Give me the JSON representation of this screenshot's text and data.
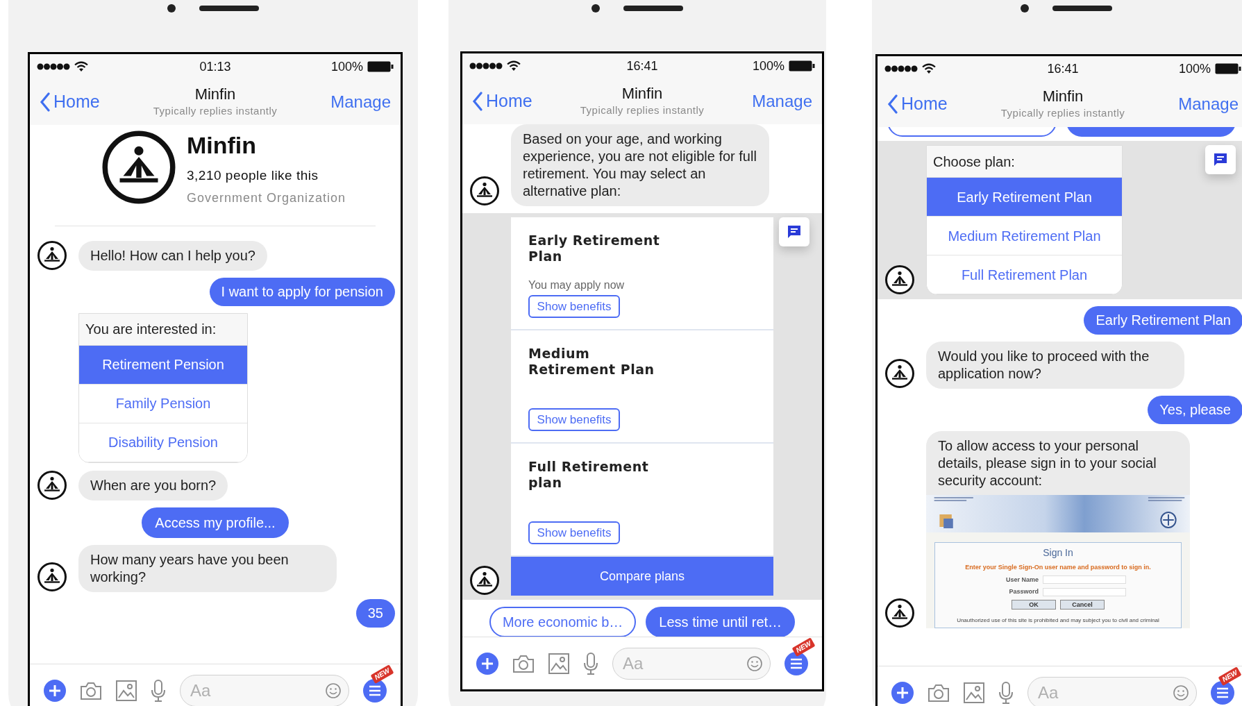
{
  "phones": [
    {
      "status": {
        "time": "01:13",
        "battery": "100%"
      },
      "header": {
        "back": "Home",
        "title": "Minfin",
        "subtitle": "Typically replies instantly",
        "action": "Manage"
      },
      "messages": [
        {
          "kind": "profile",
          "name": "Minfin",
          "likes": "3,210 people like this",
          "category": "Government Organization"
        },
        {
          "kind": "bot",
          "avatar": true,
          "text": "Hello! How can I help you?"
        },
        {
          "kind": "user",
          "text": "I want to apply for pension"
        },
        {
          "kind": "options",
          "avatar": false,
          "highlighted": false,
          "prompt": "You are interested in:",
          "options": [
            {
              "label": "Retirement Pension",
              "selected": true
            },
            {
              "label": "Family Pension",
              "selected": false
            },
            {
              "label": "Disability Pension",
              "selected": false
            }
          ]
        },
        {
          "kind": "bot",
          "avatar": true,
          "text": "When are you born?"
        },
        {
          "kind": "quick_replies",
          "replies": [
            {
              "label": "Access my profile...",
              "selected": true
            }
          ]
        },
        {
          "kind": "bot",
          "avatar": true,
          "text": "How many years have you been working?"
        },
        {
          "kind": "user",
          "text": "35"
        }
      ],
      "composer": {
        "placeholder": "Aa",
        "badge": "NEW"
      }
    },
    {
      "status": {
        "time": "16:41",
        "battery": "100%"
      },
      "header": {
        "back": "Home",
        "title": "Minfin",
        "subtitle": "Typically replies instantly",
        "action": "Manage"
      },
      "messages": [
        {
          "kind": "bot",
          "avatar": true,
          "text": "Based on your age, and working experience, you are not eligible for full retirement. You may select an alternative plan:"
        },
        {
          "kind": "plans",
          "avatar": true,
          "highlighted": true,
          "cards": [
            {
              "title": "Early Retirement Plan",
              "note": "You may apply now",
              "button": "Show benefits"
            },
            {
              "title": "Medium Retirement Plan",
              "button": "Show benefits"
            },
            {
              "title": "Full Retirement plan",
              "button": "Show benefits"
            }
          ],
          "action": "Compare plans"
        },
        {
          "kind": "quick_replies",
          "replies": [
            {
              "label": "More economic b…",
              "selected": false
            },
            {
              "label": "Less time until ret…",
              "selected": true
            }
          ]
        }
      ],
      "composer": {
        "placeholder": "Aa",
        "badge": "NEW"
      }
    },
    {
      "status": {
        "time": "16:41",
        "battery": "100%"
      },
      "header": {
        "back": "Home",
        "title": "Minfin",
        "subtitle": "Typically replies instantly",
        "action": "Manage"
      },
      "messages": [
        {
          "kind": "clipped_replies"
        },
        {
          "kind": "options",
          "avatar": true,
          "highlighted": true,
          "prompt": "Choose plan:",
          "options": [
            {
              "label": "Early Retirement Plan",
              "selected": true
            },
            {
              "label": "Medium Retirement Plan",
              "selected": false
            },
            {
              "label": "Full Retirement Plan",
              "selected": false
            }
          ]
        },
        {
          "kind": "user",
          "text": "Early Retirement Plan"
        },
        {
          "kind": "bot",
          "avatar": true,
          "text": "Would you like to proceed with the application now?"
        },
        {
          "kind": "user",
          "text": "Yes, please"
        },
        {
          "kind": "bot_image",
          "avatar": true,
          "text": "To allow access to your personal details, please sign in to your social security account:",
          "image": {
            "title": "Sign In",
            "instruction": "Enter your Single Sign-On user name and password to sign in.",
            "fields": [
              "User Name",
              "Password"
            ],
            "buttons": [
              "OK",
              "Cancel"
            ],
            "disclaimer": "Unauthorized use of this site is prohibited and may subject you to civil and criminal"
          }
        }
      ],
      "composer": {
        "placeholder": "Aa",
        "badge": "NEW"
      }
    }
  ]
}
